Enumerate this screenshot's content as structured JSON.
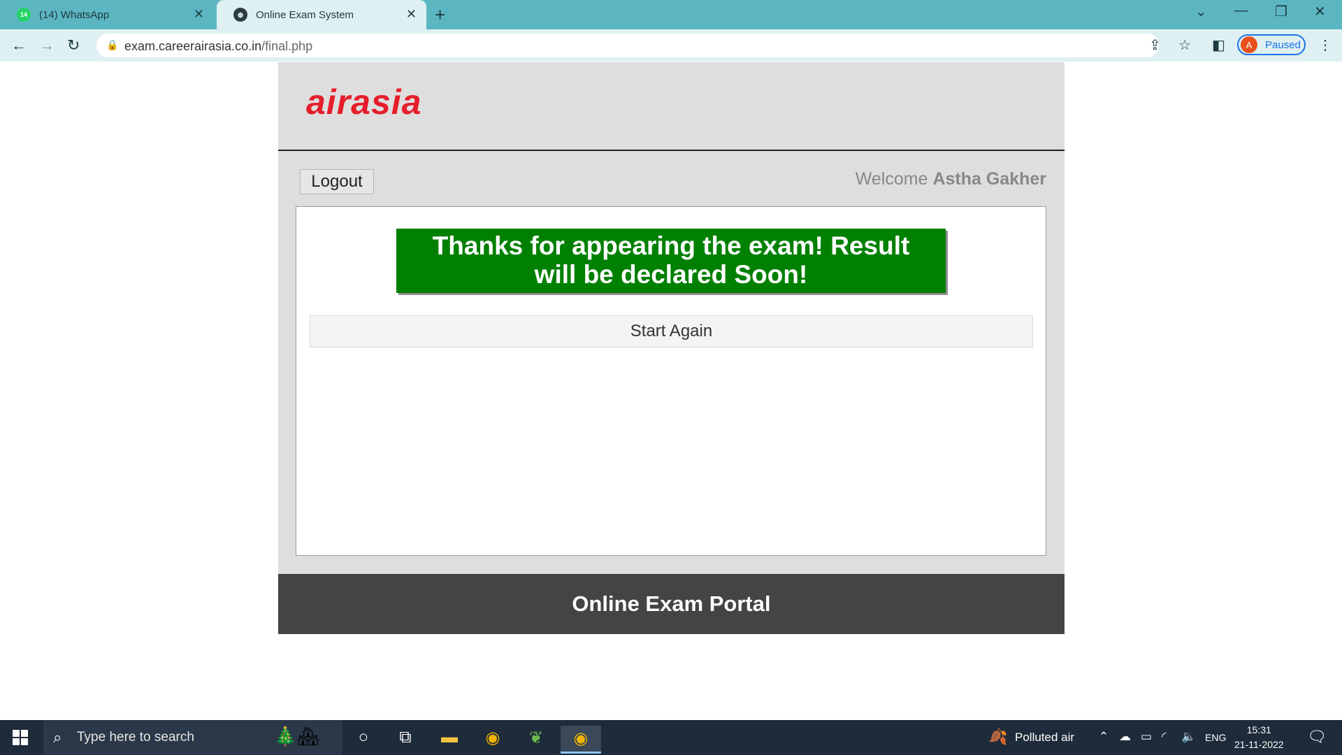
{
  "browser": {
    "tabs": [
      {
        "title": "(14) WhatsApp",
        "favicon": "whatsapp-icon",
        "badge": "14",
        "active": false
      },
      {
        "title": "Online Exam System",
        "favicon": "globe-icon",
        "active": true
      }
    ],
    "url_host": "exam.careerairasia.co.in",
    "url_path": "/final.php",
    "profile_initial": "A",
    "profile_status": "Paused"
  },
  "page": {
    "logo_text": "airasia",
    "logout_label": "Logout",
    "welcome_prefix": "Welcome",
    "user_name": "Astha Gakher",
    "banner_line1": "Thanks for appearing the exam! Result",
    "banner_line2": "will be declared Soon!",
    "start_again_label": "Start Again",
    "footer_text": "Online Exam Portal"
  },
  "taskbar": {
    "search_placeholder": "Type here to search",
    "weather_text": "Polluted air",
    "language": "ENG",
    "time": "15:31",
    "date": "21-11-2022"
  },
  "colors": {
    "tab_bar": "#5bb6c2",
    "brand_red": "#e61e2b",
    "banner_green": "#008000",
    "footer": "#444444"
  }
}
